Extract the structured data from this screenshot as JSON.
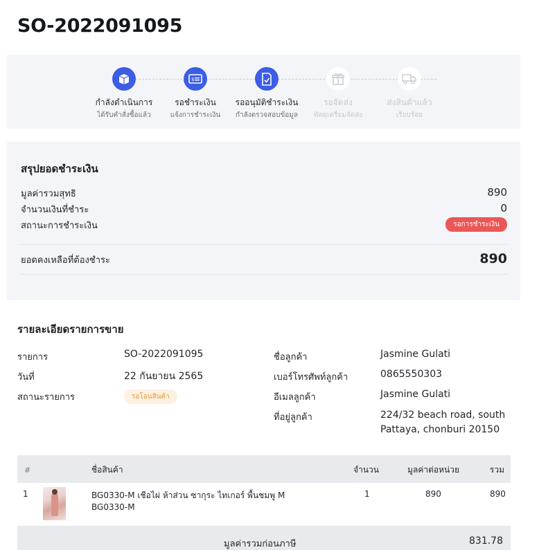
{
  "order": {
    "number": "SO-2022091095"
  },
  "steps": [
    {
      "label": "กำลังดำเนินการ",
      "sub": "ได้รับคำสั่งซื้อแล้ว",
      "icon": "box-icon",
      "active": true
    },
    {
      "label": "รอชำระเงิน",
      "sub": "แจ้งการชำระเงิน",
      "icon": "payment-card-icon",
      "active": true
    },
    {
      "label": "รออนุมัติชำระเงิน",
      "sub": "กำลังตรวจสอบข้อมูล",
      "icon": "document-check-icon",
      "active": true
    },
    {
      "label": "รอจัดส่ง",
      "sub": "พัสดุเตรียมจัดส่ง",
      "icon": "gift-box-icon",
      "active": false
    },
    {
      "label": "ส่งสินค้าแล้ว",
      "sub": "เรียบร้อย",
      "icon": "truck-icon",
      "active": false
    }
  ],
  "payment_summary": {
    "heading": "สรุปยอดชำระเงิน",
    "net_total_label": "มูลค่ารวมสุทธิ",
    "net_total_value": "890",
    "paid_label": "จำนวนเงินที่ชำระ",
    "paid_value": "0",
    "status_label": "สถานะการชำระเงิน",
    "status_badge": "รอการชำระเงิน",
    "balance_label": "ยอดคงเหลือที่ต้องชำระ",
    "balance_value": "890"
  },
  "sale_details": {
    "heading": "รายละเอียดรายการขาย",
    "order_label": "รายการ",
    "order_value": "SO-2022091095",
    "date_label": "วันที่",
    "date_value": "22 กันยายน 2565",
    "status_label": "สถานะรายการ",
    "status_badge": "รอโอนสินค้า",
    "customer_name_label": "ชื่อลูกค้า",
    "customer_name_value": "Jasmine Gulati",
    "phone_label": "เบอร์โทรศัพท์ลูกค้า",
    "phone_value": "0865550303",
    "email_label": "อีเมลลูกค้า",
    "email_value": "Jasmine Gulati",
    "address_label": "ที่อยู่ลูกค้า",
    "address_line1": "224/32 beach road, south",
    "address_line2": "Pattaya, chonburi 20150"
  },
  "items_table": {
    "headers": {
      "index": "#",
      "name": "ชื่อสินค้า",
      "qty": "จำนวน",
      "unit_price": "มูลค่าต่อหน่วย",
      "total": "รวม"
    },
    "rows": [
      {
        "index": "1",
        "name_line1": "BG0330-M เชือไผ่ ห้าส่วน ซากุระ ไทเกอร์ พื้นชมพู M",
        "name_line2": "BG0330-M",
        "qty": "1",
        "unit_price": "890",
        "total": "890"
      }
    ],
    "footer_label": "มูลค่ารวมก่อนภาษี",
    "footer_value": "831.78"
  },
  "colors": {
    "accent": "#3c5de4",
    "danger": "#eb5757",
    "warning_bg": "#fdf1e1",
    "warning_text": "#e39a3b",
    "panel_bg": "#f4f5f8"
  }
}
